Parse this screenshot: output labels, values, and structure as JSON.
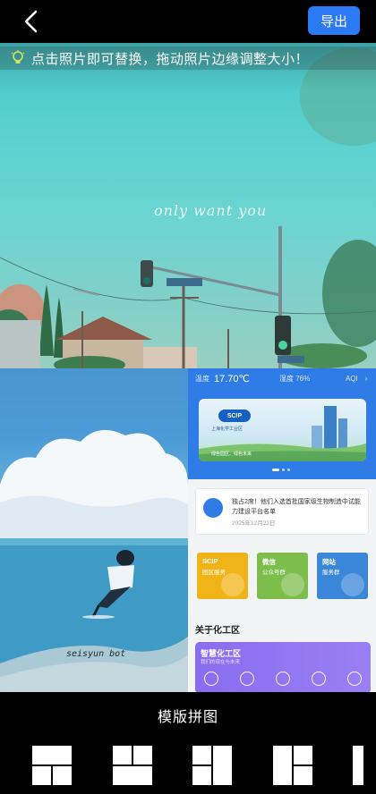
{
  "header": {
    "back_icon": "chevron-left-icon",
    "export_label": "导出"
  },
  "tip": {
    "icon": "lightbulb-icon",
    "text": "点击照片即可替换，拖动照片边缘调整大小！"
  },
  "photos": {
    "top": {
      "script_text": "only want you"
    },
    "left": {
      "signature": "seisyun bot"
    },
    "right": {
      "weather": {
        "temp_label": "温度",
        "temp_value": "17.70℃",
        "humidity": "湿度 76%",
        "aqi": "AQI"
      },
      "banner": {
        "logo": "SCIP",
        "subtitle": "上海化学工业区",
        "slogan": "绿色园区、绿色未来"
      },
      "news": {
        "title": "独占2席！他们入选首批国家级生物制造中试能力建设平台名单",
        "date": "2025年12月22日"
      },
      "tiles": [
        {
          "line1": "SCIP",
          "line2": "园区服务"
        },
        {
          "line1": "微信",
          "line2": "公众号群"
        },
        {
          "line1": "网站",
          "line2": "服务群"
        }
      ],
      "section_title": "关于化工区",
      "promo": {
        "title": "智慧化工区",
        "subtitle": "我们的现在与未来"
      }
    }
  },
  "bottom": {
    "label": "模版拼图"
  },
  "colors": {
    "accent": "#2d7bf4",
    "background": "#000000"
  }
}
